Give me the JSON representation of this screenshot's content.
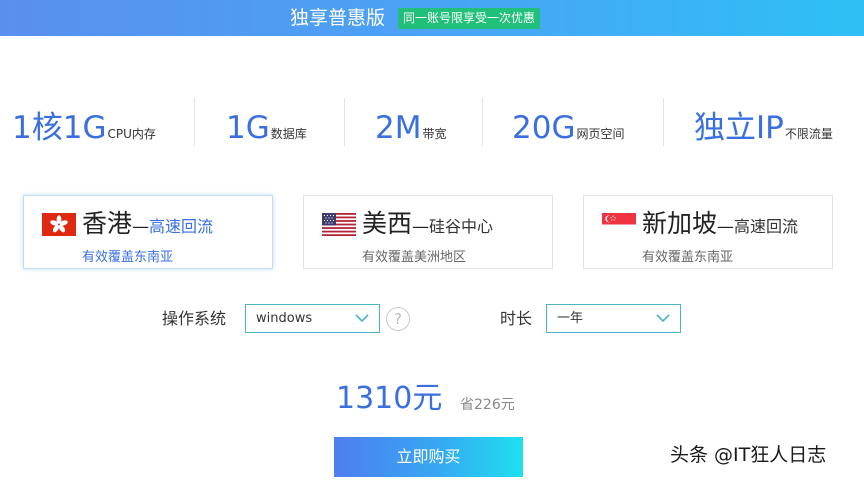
{
  "header": {
    "title": "独享普惠版",
    "badge": "同一账号限享受一次优惠"
  },
  "specs": [
    {
      "big": "1核1G",
      "small": "CPU内存"
    },
    {
      "big": "1G",
      "small": "数据库"
    },
    {
      "big": "2M",
      "small": "带宽"
    },
    {
      "big": "20G",
      "small": "网页空间"
    },
    {
      "big": "独立IP",
      "small": "不限流量"
    }
  ],
  "regions": [
    {
      "name": "香港",
      "dash": "—",
      "suffix": "高速回流",
      "sub": "有效覆盖东南亚",
      "flag": "hong-kong-flag-icon",
      "selected": true
    },
    {
      "name": "美西",
      "dash": "—",
      "suffix": "硅谷中心",
      "sub": "有效覆盖美洲地区",
      "flag": "usa-flag-icon",
      "selected": false
    },
    {
      "name": "新加坡",
      "dash": "—",
      "suffix": "高速回流",
      "sub": "有效覆盖东南亚",
      "flag": "singapore-flag-icon",
      "selected": false
    }
  ],
  "os": {
    "label": "操作系统",
    "value": "windows"
  },
  "help_icon": "?",
  "duration": {
    "label": "时长",
    "value": "一年"
  },
  "price": {
    "amount": "1310元",
    "save": "省226元"
  },
  "buy_label": "立即购买",
  "watermark": "头条 @IT狂人日志",
  "colors": {
    "accent": "#3a6fe0",
    "badge": "#21c07a",
    "select_border": "#4cb3c8"
  }
}
